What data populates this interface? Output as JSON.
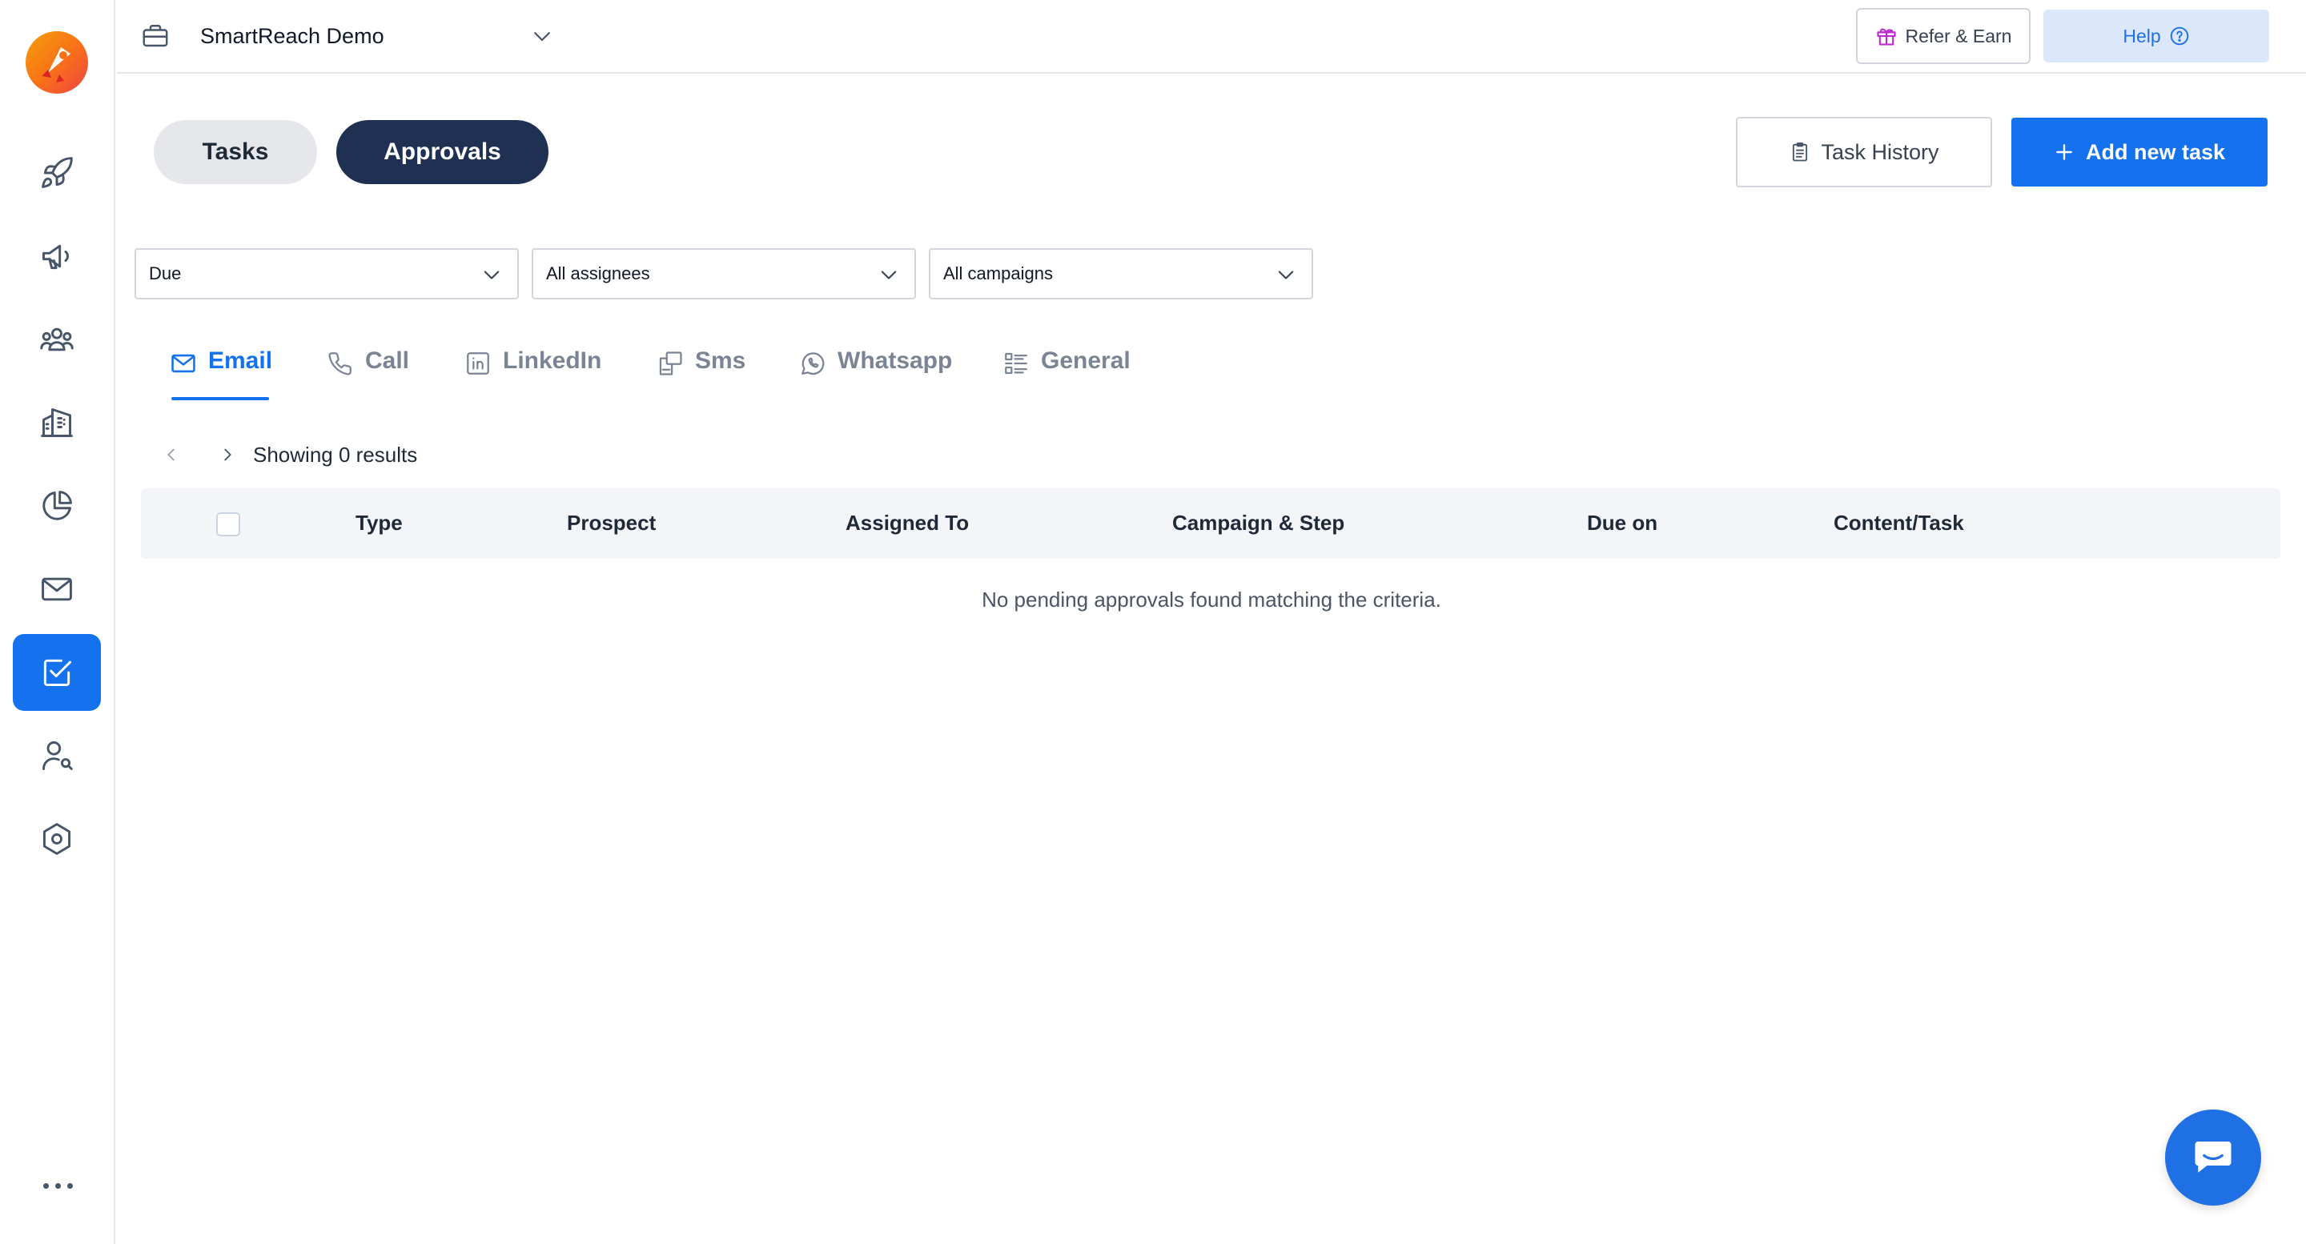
{
  "workspace": {
    "name": "SmartReach Demo"
  },
  "header": {
    "refer_label": "Refer & Earn",
    "help_label": "Help"
  },
  "toggles": {
    "tasks_label": "Tasks",
    "approvals_label": "Approvals"
  },
  "actions": {
    "history_label": "Task History",
    "add_label": "Add new task"
  },
  "filters": {
    "due": "Due",
    "assignees": "All assignees",
    "campaigns": "All campaigns"
  },
  "tabs": {
    "email": "Email",
    "call": "Call",
    "linkedin": "LinkedIn",
    "sms": "Sms",
    "whatsapp": "Whatsapp",
    "general": "General"
  },
  "pager": {
    "results_text": "Showing 0 results"
  },
  "table": {
    "columns": [
      "Type",
      "Prospect",
      "Assigned To",
      "Campaign & Step",
      "Due on",
      "Content/Task"
    ],
    "empty_message": "No pending approvals found matching the criteria."
  },
  "sidebar": {
    "items": [
      "rocket-icon",
      "megaphone-icon",
      "people-icon",
      "building-icon",
      "pie-chart-icon",
      "mail-icon",
      "tasks-icon",
      "user-search-icon",
      "settings-hexagon-icon"
    ],
    "active": "tasks-icon"
  },
  "colors": {
    "primary": "#1472ee",
    "approvals_pill": "#1f3153",
    "help_bg": "#dbe8fb",
    "gift": "#c026d3"
  }
}
